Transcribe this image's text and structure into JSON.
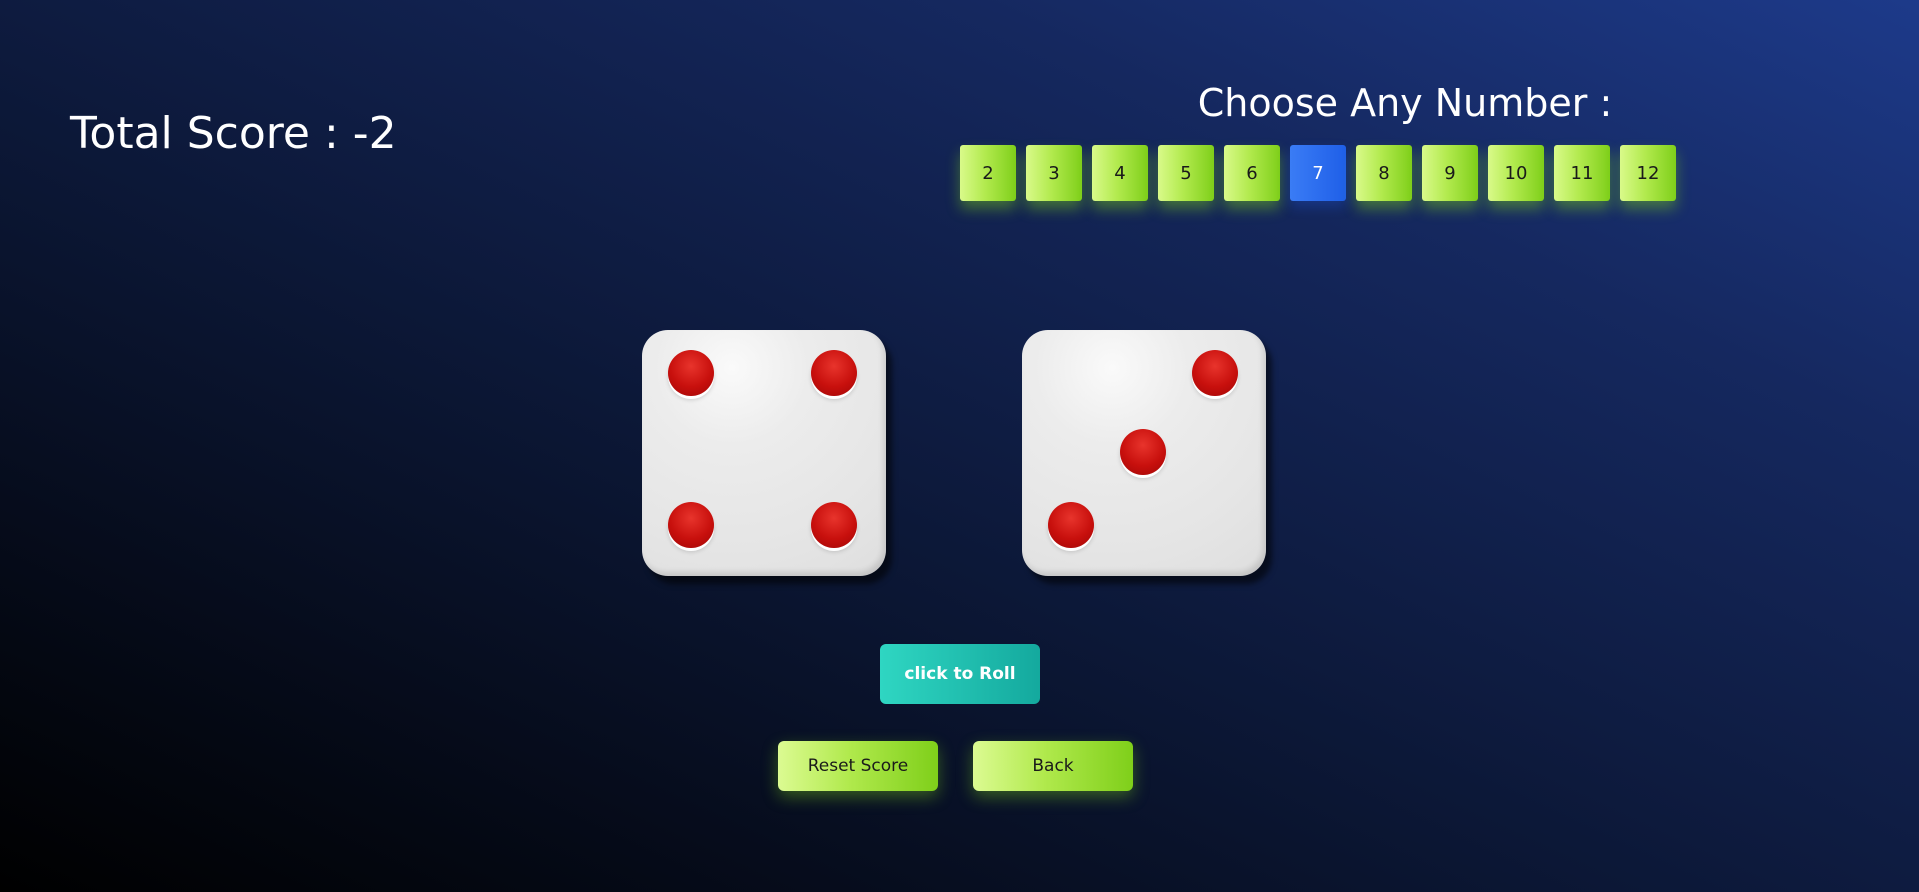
{
  "score": {
    "label": "Total Score : -2"
  },
  "chooser": {
    "title": "Choose Any Number :",
    "numbers": [
      "2",
      "3",
      "4",
      "5",
      "6",
      "7",
      "8",
      "9",
      "10",
      "11",
      "12"
    ],
    "selected": "7"
  },
  "dice": {
    "left_value": 4,
    "right_value": 3,
    "pip_color": "#d11a16",
    "face_color": "#e8e8e8"
  },
  "buttons": {
    "roll_label": "click to Roll",
    "reset_label": "Reset Score",
    "back_label": "Back"
  },
  "colors": {
    "number_button": "#b2ea4e",
    "selected_number": "#2563eb",
    "roll_button": "#1fc0b0"
  }
}
